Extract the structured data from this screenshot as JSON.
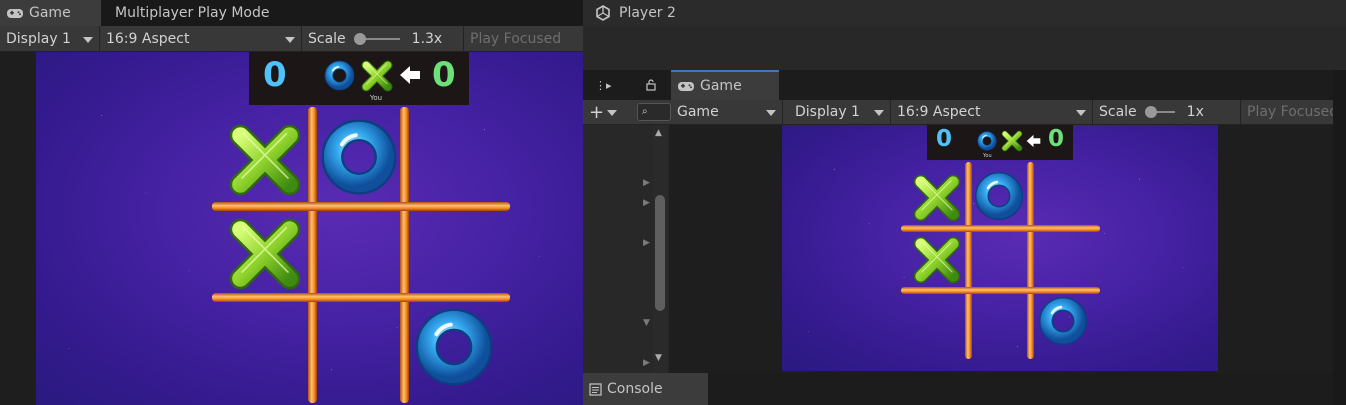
{
  "left_window": {
    "tabs": [
      {
        "label": "Game",
        "icon": "gamepad-icon"
      },
      {
        "label": "Multiplayer Play Mode"
      }
    ],
    "toolbar": {
      "display": "Display 1",
      "aspect": "16:9 Aspect",
      "scale_label": "Scale",
      "scale_value": "1.3x",
      "play_focused": "Play Focused"
    },
    "scoreboard": {
      "left_score": "0",
      "right_score": "0",
      "you_label": "You"
    }
  },
  "right_window": {
    "title": "Player 2",
    "title_icon": "unity-cube-icon",
    "tabs": [
      {
        "label": "Game",
        "icon": "gamepad-icon"
      }
    ],
    "toolbar": {
      "view_select": "Game",
      "display": "Display 1",
      "aspect": "16:9 Aspect",
      "scale_label": "Scale",
      "scale_value": "1x",
      "play_focused": "Play Focused"
    },
    "scoreboard": {
      "left_score": "0",
      "right_score": "0",
      "you_label": "You"
    },
    "console_tab": "Console"
  },
  "board": {
    "cells": [
      "X",
      "O",
      "",
      "X",
      "",
      "",
      "",
      "",
      "O"
    ]
  },
  "colors": {
    "x_green": "#7ed321",
    "o_blue": "#3aa8e8",
    "score_blue": "#4fc3f7",
    "score_green": "#6ee07a",
    "grid_orange": "#f7931e",
    "tab_accent": "#3a79bb"
  }
}
